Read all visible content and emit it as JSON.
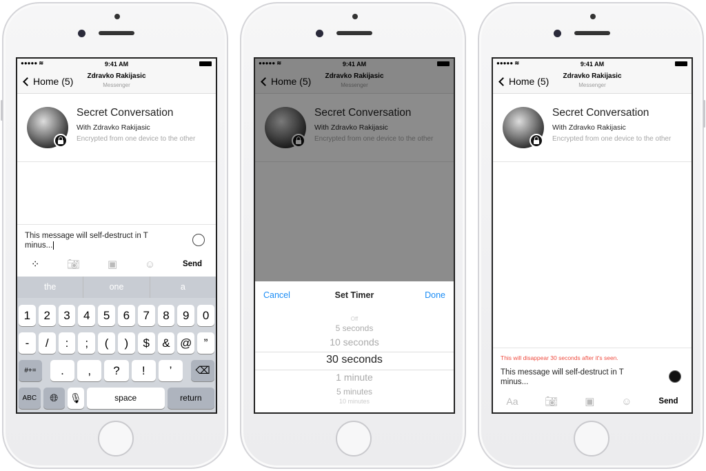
{
  "common": {
    "time": "9:41 AM",
    "back": "Home (5)",
    "contact": "Zdravko Rakijasic",
    "app": "Messenger",
    "heading": "Secret Conversation",
    "with": "With Zdravko Rakijasic",
    "encrypted": "Encrypted from one device to the other",
    "send": "Send",
    "accent": "#1a8cf5"
  },
  "phone1": {
    "message": "This message will self-destruct in T minus...",
    "suggestions": [
      "the",
      "one",
      "a"
    ],
    "row1": [
      "1",
      "2",
      "3",
      "4",
      "5",
      "6",
      "7",
      "8",
      "9",
      "0"
    ],
    "row2": [
      "-",
      "/",
      ":",
      ";",
      "(",
      ")",
      "$",
      "&",
      "@",
      "”"
    ],
    "row3": [
      ".",
      ",",
      "?",
      "!",
      "’"
    ],
    "symbols": "#+=",
    "abc": "ABC",
    "space": "space",
    "return": "return"
  },
  "phone2": {
    "cancel": "Cancel",
    "title": "Set Timer",
    "done": "Done",
    "options": [
      "Off",
      "5 seconds",
      "10 seconds",
      "30 seconds",
      "1 minute",
      "5 minutes",
      "10 minutes"
    ],
    "selected": "30 seconds"
  },
  "phone3": {
    "notice": "This will disappear 30 seconds after it's seen.",
    "notice_color": "#ef4b3f",
    "message": "This message will self-destruct in T minus...",
    "aa": "Aa"
  }
}
